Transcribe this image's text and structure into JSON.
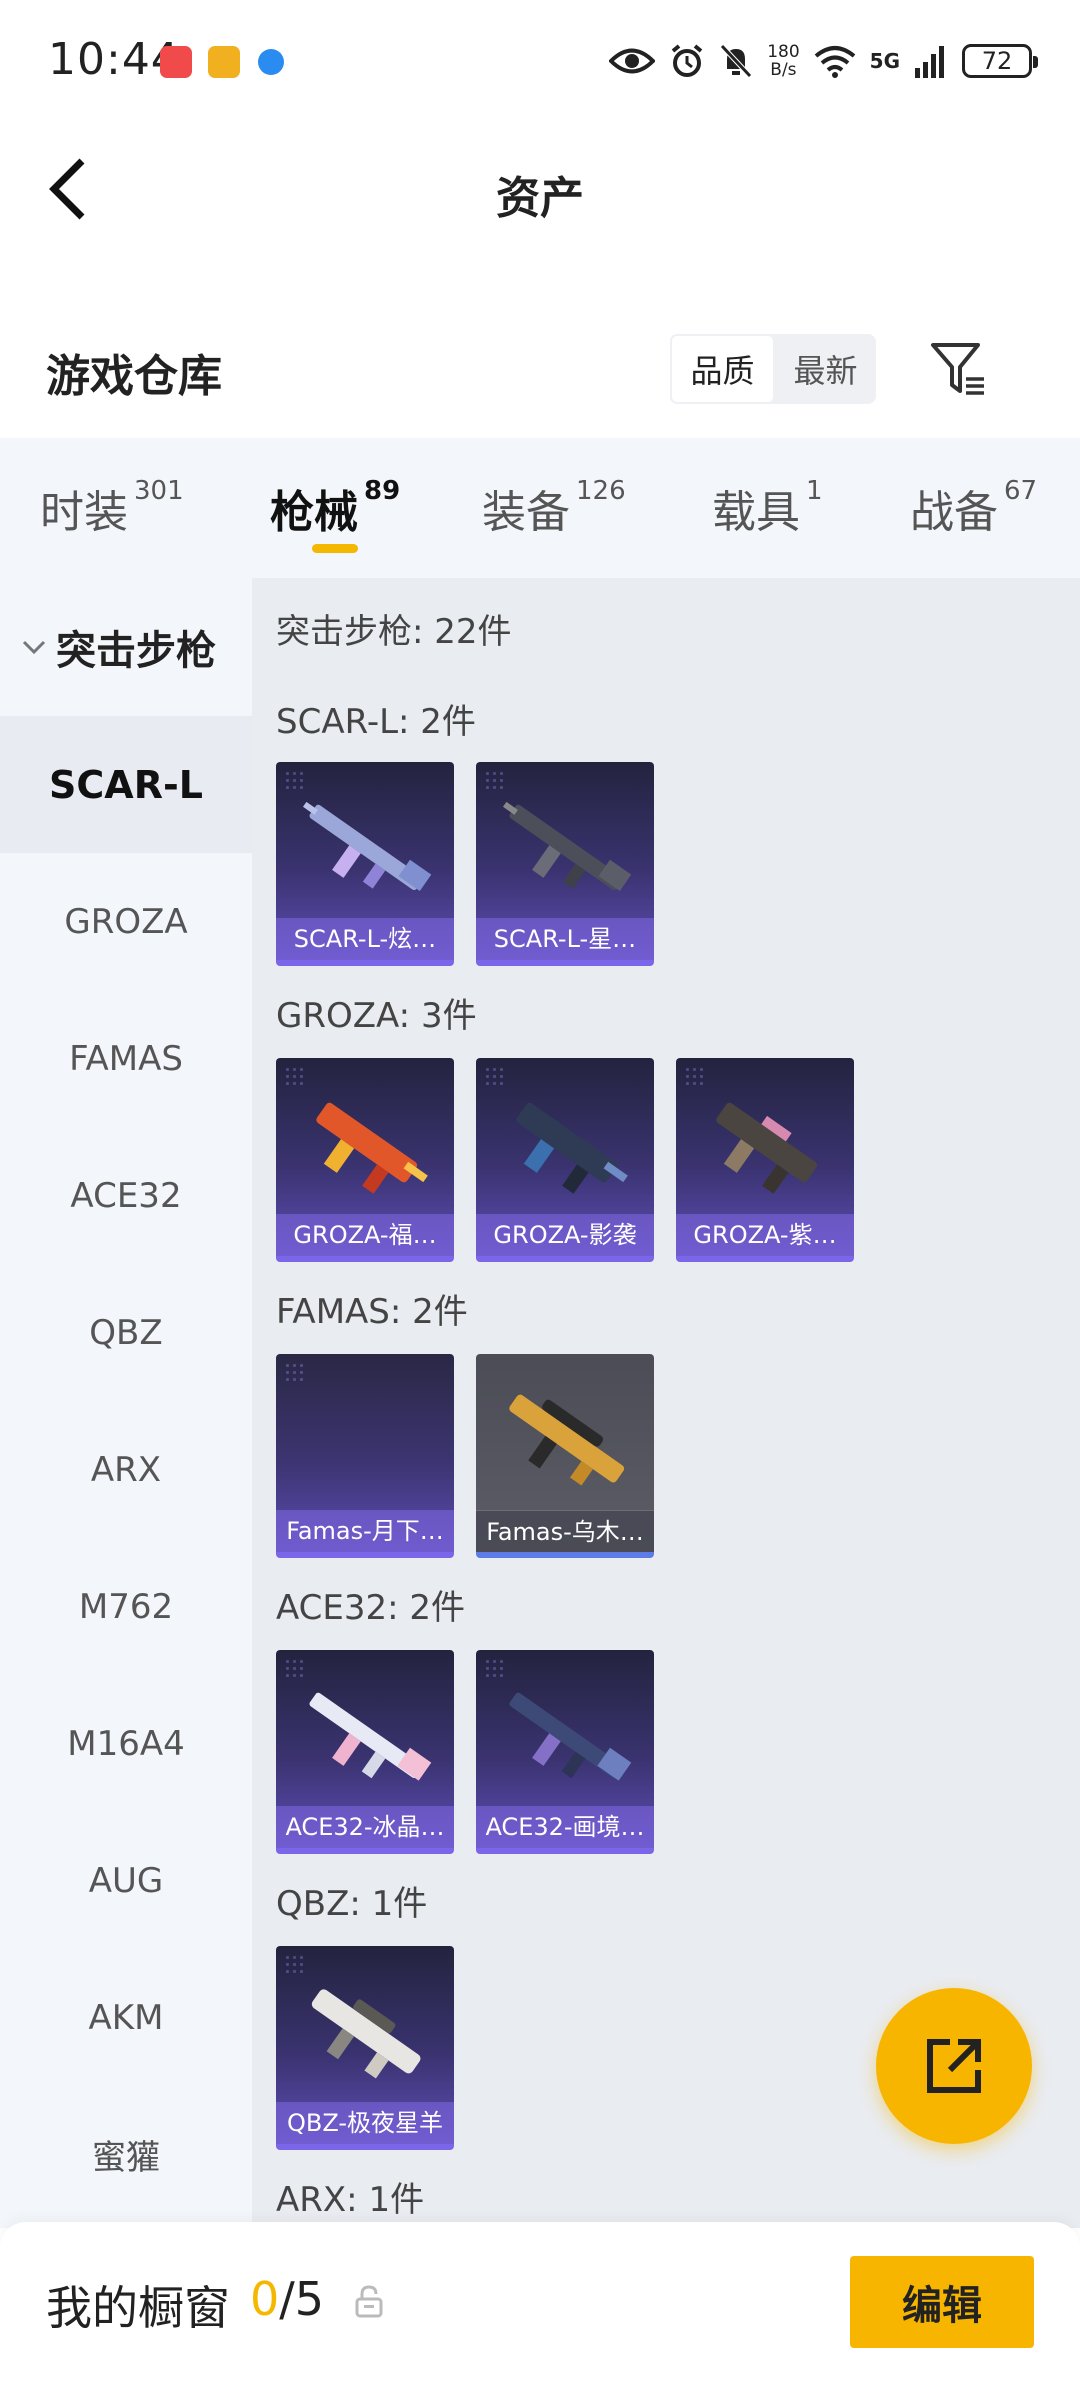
{
  "status_bar": {
    "time": "10:44",
    "net_speed_value": "180",
    "net_speed_unit": "B/s",
    "network_type": "5G",
    "battery": "72"
  },
  "nav": {
    "title": "资产"
  },
  "section": {
    "title": "游戏仓库",
    "sort_options": [
      "品质",
      "最新"
    ],
    "sort_active": "品质"
  },
  "tabs": [
    {
      "label": "时装",
      "count": "301"
    },
    {
      "label": "枪械",
      "count": "89"
    },
    {
      "label": "装备",
      "count": "126"
    },
    {
      "label": "载具",
      "count": "1"
    },
    {
      "label": "战备",
      "count": "67"
    }
  ],
  "active_tab": "枪械",
  "sidebar": {
    "category": "突击步枪",
    "items": [
      "SCAR-L",
      "GROZA",
      "FAMAS",
      "ACE32",
      "QBZ",
      "ARX",
      "M762",
      "M16A4",
      "AUG",
      "AKM",
      "蜜獾"
    ],
    "active_item": "SCAR-L"
  },
  "content": {
    "summary": "突击步枪: 22件",
    "groups": [
      {
        "title": "SCAR-L: 2件",
        "items": [
          "SCAR-L-炫…",
          "SCAR-L-星…"
        ]
      },
      {
        "title": "GROZA: 3件",
        "items": [
          "GROZA-福…",
          "GROZA-影袭",
          "GROZA-紫…"
        ]
      },
      {
        "title": "FAMAS: 2件",
        "items": [
          "Famas-月下…",
          "Famas-乌木…"
        ]
      },
      {
        "title": "ACE32: 2件",
        "items": [
          "ACE32-冰晶…",
          "ACE32-画境…"
        ]
      },
      {
        "title": "QBZ: 1件",
        "items": [
          "QBZ-极夜星羊"
        ]
      },
      {
        "title": "ARX: 1件",
        "items": []
      }
    ]
  },
  "bottom_bar": {
    "title": "我的橱窗",
    "current": "0",
    "total": "/5",
    "edit_label": "编辑"
  },
  "colors": {
    "accent": "#f7b500",
    "card_purple": "#5d4db6",
    "card_grey": "#5c5d66"
  },
  "icons": [
    "back-icon",
    "filter-icon",
    "chevron-down-icon",
    "share-icon",
    "lock-icon",
    "eye-icon",
    "alarm-icon",
    "mute-icon",
    "wifi-icon",
    "signal-icon",
    "battery-icon"
  ]
}
